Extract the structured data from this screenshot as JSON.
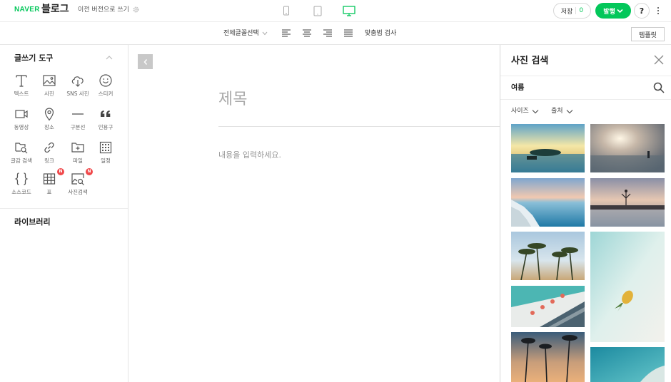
{
  "header": {
    "brand": "NAVER",
    "product": "블로그",
    "legacy_link": "이전 버전으로 쓰기",
    "save_label": "저장",
    "save_count": "0",
    "publish_label": "발행",
    "help_label": "?"
  },
  "toolbar": {
    "font_select": "전체글꼴선택",
    "spellcheck": "맞춤법 검사",
    "template": "템플릿"
  },
  "left_panel": {
    "title": "글쓰기 도구",
    "library_title": "라이브러리",
    "tools": [
      {
        "label": "텍스트",
        "icon": "text-icon"
      },
      {
        "label": "사진",
        "icon": "photo-icon"
      },
      {
        "label": "SNS 사진",
        "icon": "sns-photo-icon"
      },
      {
        "label": "스티커",
        "icon": "sticker-icon"
      },
      {
        "label": "동영상",
        "icon": "video-icon"
      },
      {
        "label": "장소",
        "icon": "place-icon"
      },
      {
        "label": "구분선",
        "icon": "divider-icon"
      },
      {
        "label": "인용구",
        "icon": "quote-icon"
      },
      {
        "label": "글감 검색",
        "icon": "material-search-icon"
      },
      {
        "label": "링크",
        "icon": "link-icon"
      },
      {
        "label": "파일",
        "icon": "file-icon"
      },
      {
        "label": "일정",
        "icon": "schedule-icon"
      },
      {
        "label": "소스코드",
        "icon": "code-icon"
      },
      {
        "label": "표",
        "icon": "table-icon",
        "badge": "N"
      },
      {
        "label": "사진검색",
        "icon": "photo-search-icon",
        "badge": "N"
      }
    ]
  },
  "editor": {
    "title_placeholder": "제목",
    "body_placeholder": "내용을 입력하세요."
  },
  "right_panel": {
    "title": "사진 검색",
    "query": "여름",
    "filter_size": "사이즈",
    "filter_source": "출처",
    "photos": [
      {
        "name": "photo-island-sunset"
      },
      {
        "name": "photo-beach-sun"
      },
      {
        "name": "photo-rocky-coast"
      },
      {
        "name": "photo-pier-person"
      },
      {
        "name": "photo-palm-trees"
      },
      {
        "name": "photo-pineapple-sand"
      },
      {
        "name": "photo-aerial-beach"
      },
      {
        "name": "photo-palm-silhouette"
      },
      {
        "name": "photo-aerial-sea"
      }
    ]
  },
  "colors": {
    "brand_green": "#03c75a",
    "badge_red": "#f0494b"
  }
}
